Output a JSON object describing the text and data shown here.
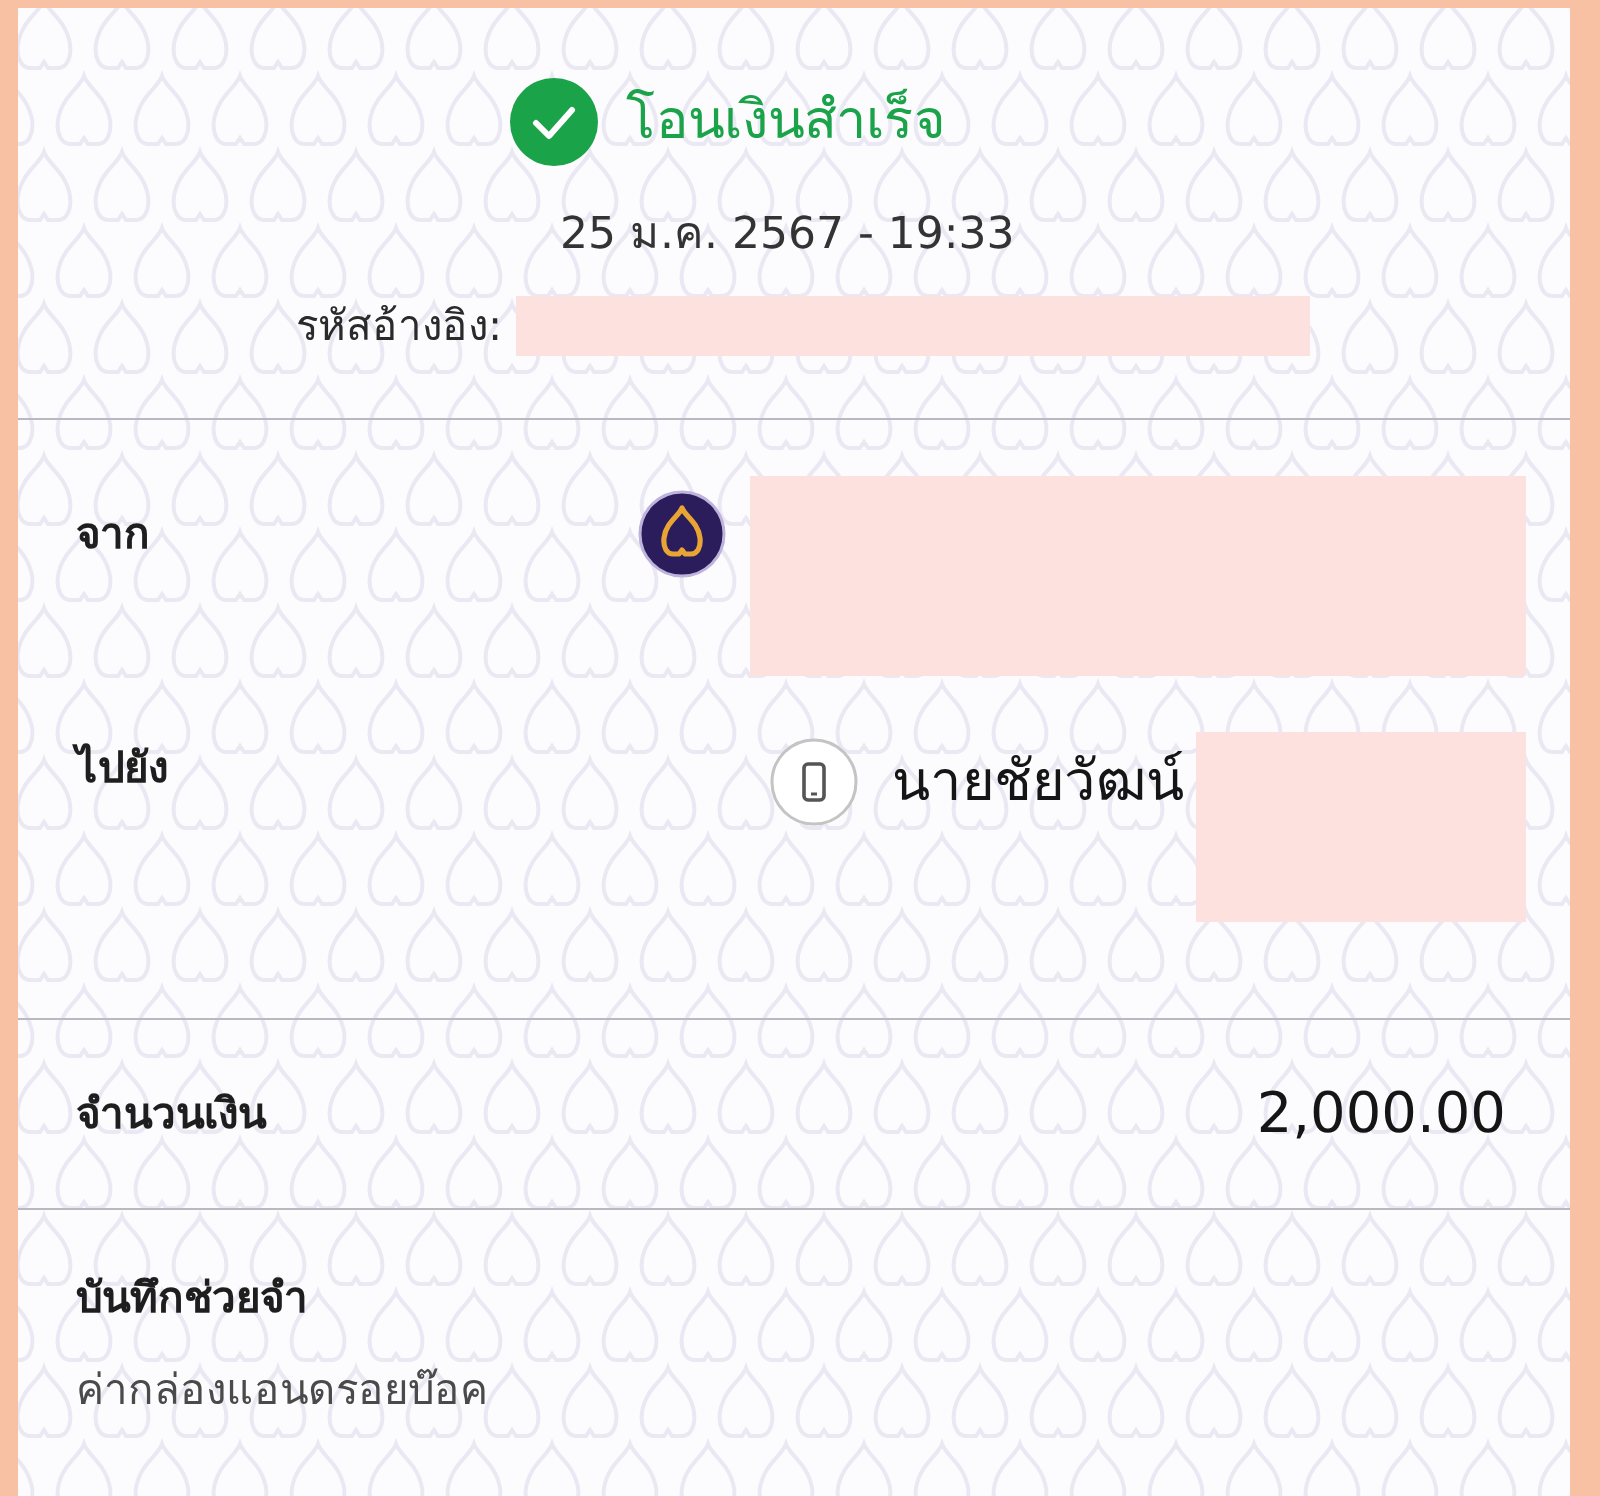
{
  "header": {
    "status": {
      "kind": "success",
      "text": "โอนเงินสำเร็จ"
    },
    "datetime": "25 ม.ค. 2567 - 19:33",
    "reference": {
      "label": "รหัสอ้างอิง:",
      "redacted": true
    }
  },
  "parties": [
    {
      "label": "จาก",
      "kind": "bank",
      "redacted": true
    },
    {
      "label": "ไปยัง",
      "kind": "phone",
      "name": "นายชัยวัฒน์",
      "redacted": true
    }
  ],
  "amount": {
    "label": "จำนวนเงิน",
    "value": "2,000.00"
  },
  "memo": {
    "label": "บันทึกช่วยจำ",
    "text": "ค่ากล่องแอนดรอยบ๊อค"
  }
}
